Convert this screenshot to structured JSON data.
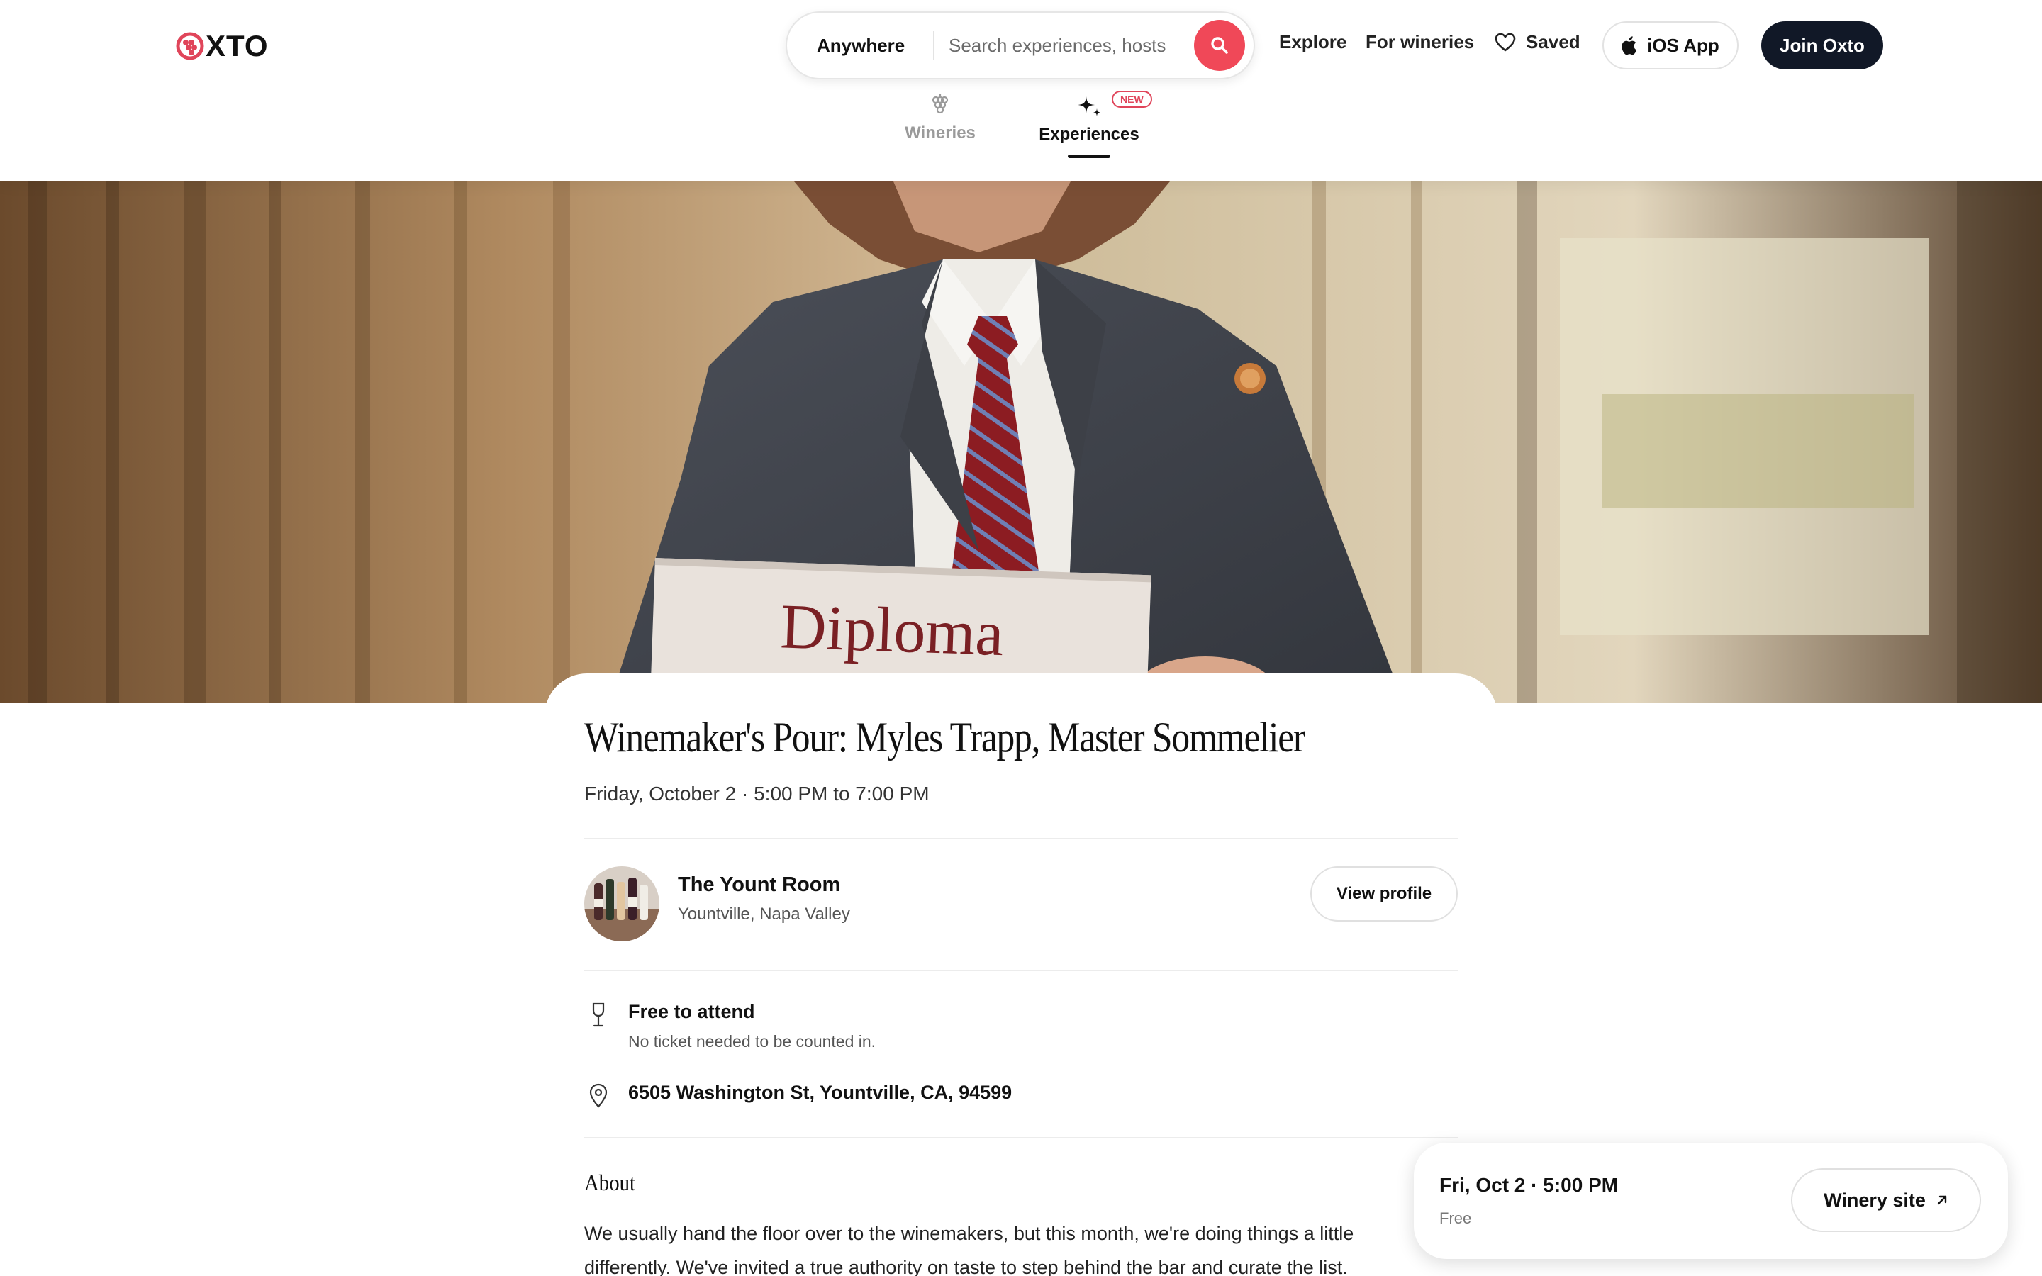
{
  "header": {
    "logo_text": "XTO",
    "search": {
      "location": "Anywhere",
      "placeholder": "Search experiences, hosts"
    },
    "nav": {
      "explore": "Explore",
      "wineries": "For wineries",
      "saved": "Saved"
    },
    "ios_label": "iOS App",
    "join_label": "Join Oxto",
    "tabs": [
      {
        "label": "Wineries",
        "active": false
      },
      {
        "label": "Experiences",
        "active": true,
        "badge": "NEW"
      }
    ]
  },
  "hero": {
    "sign_text": "Diploma"
  },
  "event": {
    "title": "Winemaker's Pour: Myles Trapp, Master Sommelier",
    "datetime": "Friday, October 2 · 5:00 PM to 7:00 PM",
    "host": {
      "name": "The Yount Room",
      "location": "Yountville, Napa Valley",
      "profile_label": "View profile"
    },
    "admission": {
      "title": "Free to attend",
      "subtitle": "No ticket needed to be counted in."
    },
    "address": "6505 Washington St, Yountville, CA, 94599",
    "about": {
      "heading": "About",
      "text": "We usually hand the floor over to the winemakers, but this month, we're doing things a little differently. We've invited a true authority on taste to step behind the bar and curate the list."
    }
  },
  "booking": {
    "when": "Fri, Oct 2 · 5:00 PM",
    "price": "Free",
    "site_label": "Winery site"
  },
  "colors": {
    "brand_red": "#e0455a",
    "search_button": "#f04858",
    "join_button": "#111827"
  },
  "icons": [
    "grape-logo-icon",
    "search-icon",
    "heart-icon",
    "apple-icon",
    "grapes-icon",
    "sparkle-icon",
    "wine-glass-icon",
    "map-pin-icon",
    "arrow-up-right-icon"
  ]
}
